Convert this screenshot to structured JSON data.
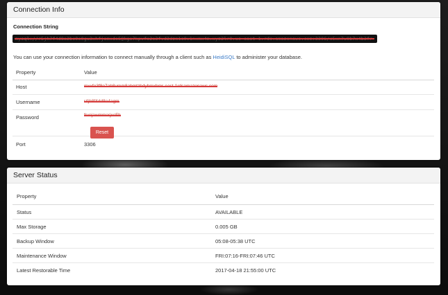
{
  "connection_panel": {
    "title": "Connection Info",
    "cs_label": "Connection String",
    "cs_value": "mysql://r5jh7f4d8a2bc9e0gu3xhfjamxde5@kgo7kpvfe2o3fvd2dzm1s0v1nxmx4m.xyz2lr0.us-east-1.rds.amazonaws.com:3306/c5xn7w0b7x4b3fr",
    "info_before": "You can use your connection information to connect manually through a client such as ",
    "info_link": "HeidiSQL",
    "info_after": " to administer your database.",
    "col_property": "Property",
    "col_value": "Value",
    "rows": [
      {
        "key": "Host",
        "value": "mxxfo3f8o7ab8umm8abmtzhdyhmxbmr-east-1rdsamazonaws.com"
      },
      {
        "key": "Username",
        "value": "r4jh8f4dd8o4agm"
      },
      {
        "key": "Password",
        "value": "frvnjawmmorjxcFh"
      },
      {
        "key": "Port",
        "value": "3306"
      }
    ],
    "reset_label": "Reset"
  },
  "server_panel": {
    "title": "Server Status",
    "col_property": "Property",
    "col_value": "Value",
    "rows": [
      {
        "key": "Status",
        "value": "AVAILABLE"
      },
      {
        "key": "Max Storage",
        "value": "0.005 GB"
      },
      {
        "key": "Backup Window",
        "value": "05:08-05:38 UTC"
      },
      {
        "key": "Maintenance Window",
        "value": "FRI:07:16-FRI:07:46 UTC"
      },
      {
        "key": "Latest Restorable Time",
        "value": "2017-04-18 21:55:00 UTC"
      }
    ]
  },
  "colors": {
    "link": "#3a7bc8",
    "reset_button": "#d9534f",
    "redaction": "#d63a3a"
  }
}
